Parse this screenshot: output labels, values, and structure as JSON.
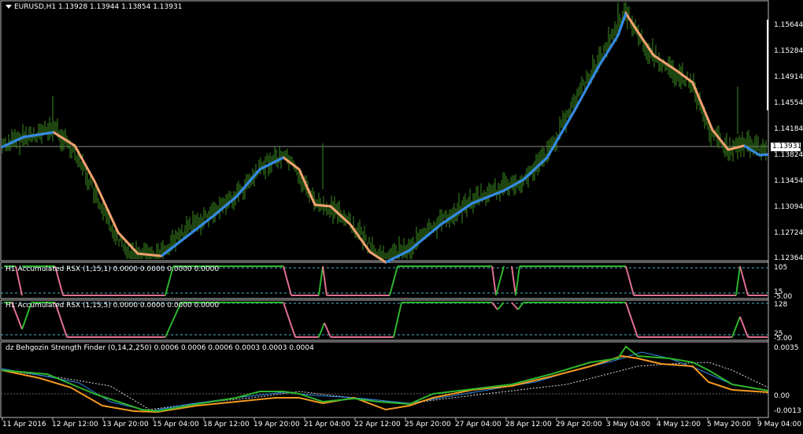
{
  "window": {
    "title": "EURUSD,H1  1.13928 1.13944 1.13854 1.13931"
  },
  "main_chart": {
    "current_price": "1.13931",
    "price_labels": [
      "1.15644",
      "1.15284",
      "1.14914",
      "1.14554",
      "1.14184",
      "1.13824",
      "1.13454",
      "1.13094",
      "1.12724",
      "1.12364"
    ]
  },
  "indicators": [
    {
      "label": "H1 Accumulated RSX (1,15,1) 0.0000 0.0000 0.0000 0.0000",
      "levels": [
        "105",
        "15",
        "-5.00"
      ]
    },
    {
      "label": "H1 Accumulated RSX (1,15,5) 0.0000 0.0000 0.0000 0.0000",
      "levels": [
        "128",
        "25",
        "-5.00"
      ]
    },
    {
      "label": "dz Behgozin Strength Finder (0,14,2,250) 0.0006 0.0006 0.0006 0.0003 0.0003 0.0004",
      "levels": [
        "0.0035",
        "0.00",
        "-0.0013"
      ]
    }
  ],
  "time_axis": [
    "11 Apr 2016",
    "12 Apr 12:00",
    "13 Apr 20:00",
    "15 Apr 04:00",
    "18 Apr 12:00",
    "19 Apr 20:00",
    "21 Apr 04:00",
    "22 Apr 12:00",
    "25 Apr 20:00",
    "27 Apr 04:00",
    "28 Apr 12:00",
    "29 Apr 20:00",
    "3 May 04:00",
    "4 May 12:00",
    "5 May 20:00",
    "9 May 04:00"
  ],
  "colors": {
    "background": "#000000",
    "bars": "#3c8a1f",
    "ma_up": "#2f8ae8",
    "ma_down": "#f2a270",
    "rsx_up": "#2db52d",
    "rsx_down": "#e0708e",
    "level_line": "#4fb3c8",
    "strength_green": "#2db52d",
    "strength_orange": "#f39a21",
    "strength_blue": "#2f8ae8"
  }
}
